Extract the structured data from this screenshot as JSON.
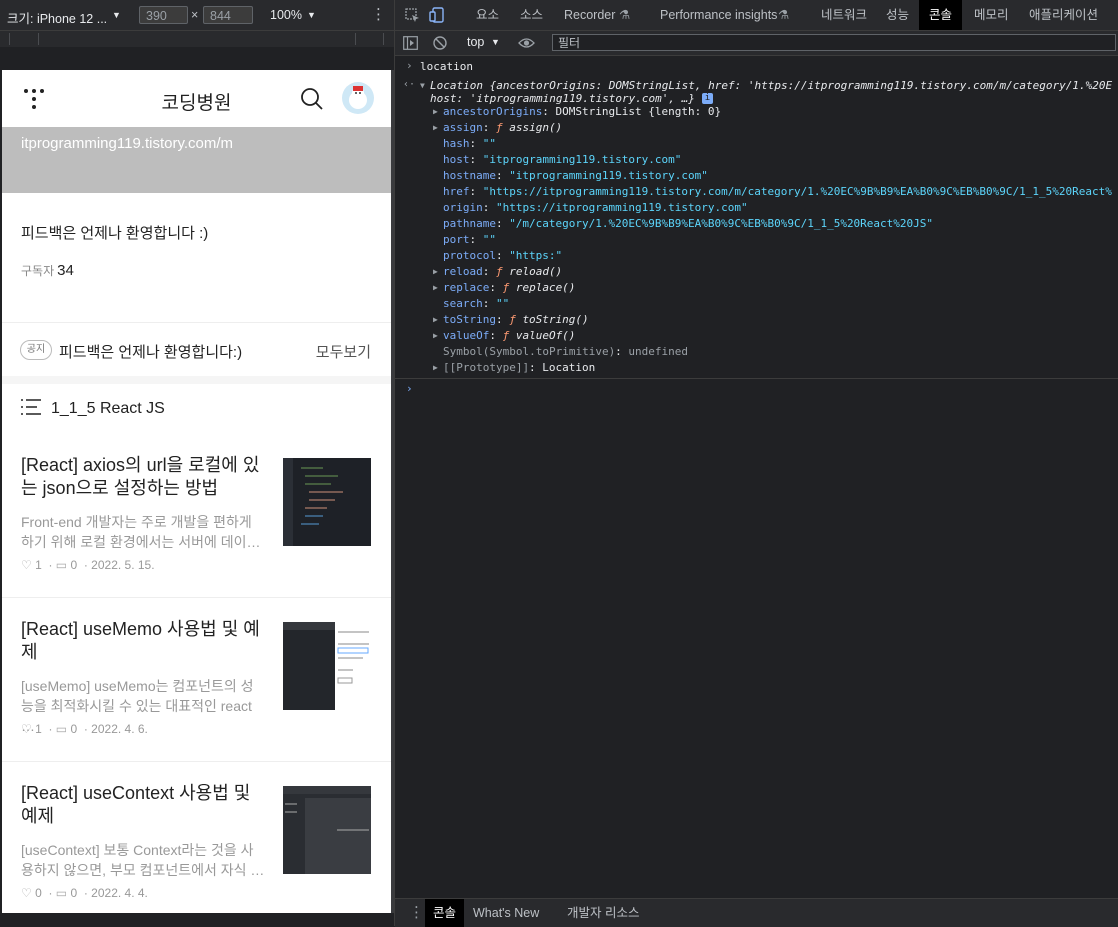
{
  "device_toolbar": {
    "device_label": "크기: iPhone 12 ...",
    "width": "390",
    "times": "×",
    "height": "844",
    "zoom": "100%"
  },
  "phone": {
    "blog_title": "코딩병원",
    "blog_url": "itprogramming119.tistory.com/m",
    "intro": "피드백은 언제나 환영합니다 :)",
    "subscribers_label": "구독자",
    "subscribers_count": "34",
    "notice_badge": "공지",
    "notice_text": "피드백은 언제나 환영합니다:)",
    "notice_more": "모두보기",
    "category": "1_1_5 React JS",
    "posts": [
      {
        "title": "[React] axios의 url을 로컬에 있는 json으로 설정하는 방법",
        "excerpt": "Front-end 개발자는 주로 개발을 편하게 하기 위해 로컬 환경에서는 서버에 데이…",
        "likes": "1",
        "comments": "0",
        "date": "2022. 5. 15."
      },
      {
        "title": "[React] useMemo 사용법 및 예제",
        "excerpt": "[useMemo] useMemo는 컴포넌트의 성능을 최적화시킬 수 있는 대표적인 react …",
        "likes": "1",
        "comments": "0",
        "date": "2022. 4. 6."
      },
      {
        "title": "[React] useContext 사용법 및 예제",
        "excerpt": "[useContext] 보통 Context라는 것을 사용하지 않으면, 부모 컴포넌트에서 자식 …",
        "likes": "0",
        "comments": "0",
        "date": "2022. 4. 4."
      }
    ]
  },
  "devtools": {
    "tabs": [
      "요소",
      "소스",
      "Recorder",
      "Performance insights",
      "네트워크",
      "성능",
      "콘솔",
      "메모리",
      "애플리케이션"
    ],
    "active_tab": "콘솔",
    "context": "top",
    "filter_placeholder": "필터",
    "console": {
      "input": "location",
      "summary_head": "Location {ancestorOrigins: DOMStringList, href: 'https://itprogramming119.tistory.com/m/category/1.%20E",
      "summary_tail": "host: 'itprogramming119.tistory.com', …}",
      "info_badge": "i",
      "props": [
        {
          "key": "ancestorOrigins",
          "value": "DOMStringList {length: 0}",
          "expandable": true,
          "type": "obj"
        },
        {
          "key": "assign",
          "value": "ƒ assign()",
          "expandable": true,
          "type": "fn"
        },
        {
          "key": "hash",
          "value": "\"\"",
          "expandable": false,
          "type": "str"
        },
        {
          "key": "host",
          "value": "\"itprogramming119.tistory.com\"",
          "expandable": false,
          "type": "str"
        },
        {
          "key": "hostname",
          "value": "\"itprogramming119.tistory.com\"",
          "expandable": false,
          "type": "str"
        },
        {
          "key": "href",
          "value": "\"https://itprogramming119.tistory.com/m/category/1.%20EC%9B%B9%EA%B0%9C%EB%B0%9C/1_1_5%20React%",
          "expandable": false,
          "type": "str"
        },
        {
          "key": "origin",
          "value": "\"https://itprogramming119.tistory.com\"",
          "expandable": false,
          "type": "str"
        },
        {
          "key": "pathname",
          "value": "\"/m/category/1.%20EC%9B%B9%EA%B0%9C%EB%B0%9C/1_1_5%20React%20JS\"",
          "expandable": false,
          "type": "str"
        },
        {
          "key": "port",
          "value": "\"\"",
          "expandable": false,
          "type": "str"
        },
        {
          "key": "protocol",
          "value": "\"https:\"",
          "expandable": false,
          "type": "str"
        },
        {
          "key": "reload",
          "value": "ƒ reload()",
          "expandable": true,
          "type": "fn"
        },
        {
          "key": "replace",
          "value": "ƒ replace()",
          "expandable": true,
          "type": "fn"
        },
        {
          "key": "search",
          "value": "\"\"",
          "expandable": false,
          "type": "str"
        },
        {
          "key": "toString",
          "value": "ƒ toString()",
          "expandable": true,
          "type": "fn"
        },
        {
          "key": "valueOf",
          "value": "ƒ valueOf()",
          "expandable": true,
          "type": "fn"
        },
        {
          "key": "Symbol(Symbol.toPrimitive)",
          "value": "undefined",
          "expandable": false,
          "type": "dim"
        },
        {
          "key": "[[Prototype]]",
          "value": "Location",
          "expandable": true,
          "type": "proto"
        }
      ]
    },
    "drawer_tabs": [
      "콘솔",
      "What's New",
      "개발자 리소스"
    ]
  }
}
